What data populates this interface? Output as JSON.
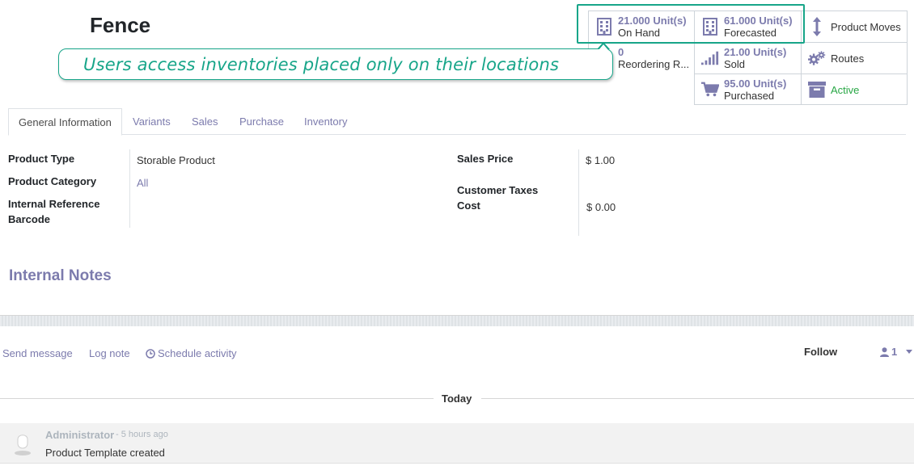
{
  "product": {
    "title": "Fence"
  },
  "smart_buttons": {
    "on_hand": {
      "value": "21.000 Unit(s)",
      "label": "On Hand",
      "icon": "building-icon"
    },
    "forecasted": {
      "value": "61.000 Unit(s)",
      "label": "Forecasted",
      "icon": "building-icon"
    },
    "product_moves": {
      "label": "Product Moves",
      "icon": "up-down-arrow-icon"
    },
    "reordering": {
      "value": "0",
      "label": "Reordering R...",
      "icon": "refresh-icon"
    },
    "sold": {
      "value": "21.00 Unit(s)",
      "label": "Sold",
      "icon": "signal-bars-icon"
    },
    "routes": {
      "label": "Routes",
      "icon": "cogs-icon"
    },
    "purchased": {
      "value": "95.00 Unit(s)",
      "label": "Purchased",
      "icon": "cart-icon"
    },
    "active": {
      "label": "Active",
      "icon": "archive-icon",
      "color": "#28a745"
    }
  },
  "callout": {
    "text": "Users access inventories placed only on their locations",
    "color": "#17a589"
  },
  "tabs": [
    {
      "label": "General Information",
      "active": true
    },
    {
      "label": "Variants"
    },
    {
      "label": "Sales"
    },
    {
      "label": "Purchase"
    },
    {
      "label": "Inventory"
    }
  ],
  "fields_left": {
    "product_type": {
      "label": "Product Type",
      "value": "Storable Product"
    },
    "product_category": {
      "label": "Product Category",
      "value": "All"
    },
    "internal_reference": {
      "label": "Internal Reference"
    },
    "barcode": {
      "label": "Barcode"
    }
  },
  "fields_right": {
    "sales_price": {
      "label": "Sales Price",
      "value": "$ 1.00"
    },
    "customer_taxes": {
      "label": "Customer Taxes"
    },
    "cost": {
      "label": "Cost",
      "value": "$ 0.00"
    }
  },
  "notes": {
    "title": "Internal Notes"
  },
  "chatter": {
    "send_message": "Send message",
    "log_note": "Log note",
    "schedule_activity": "Schedule activity",
    "follow": "Follow",
    "followers_count": "1",
    "date_separator": "Today",
    "message": {
      "author": "Administrator",
      "time_ago": "- 5 hours ago",
      "body": "Product Template created"
    }
  },
  "colors": {
    "primary": "#7c7bad",
    "accent": "#17a589",
    "active": "#28a745"
  }
}
